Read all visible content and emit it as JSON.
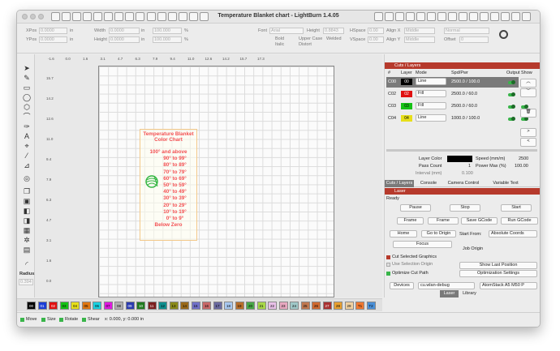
{
  "window": {
    "title": "Temperature Blanket chart - LightBurn 1.4.05"
  },
  "toolbar": {
    "xpos_label": "XPos",
    "xpos_value": "0.0000",
    "ypos_label": "YPos",
    "ypos_value": "0.0000",
    "unit": "in",
    "width_label": "Width",
    "width_value": "0.0000",
    "height_label": "Height",
    "height_value": "0.0000",
    "pct_w": "100.000",
    "pct_h": "100.000",
    "pct_sign": "%",
    "font_label": "Font",
    "font_value": "Arial",
    "height2_label": "Height",
    "height2_value": "0.8843",
    "hspace_label": "HSpace",
    "hspace_value": "0.00",
    "vspace_label": "VSpace",
    "vspace_value": "0.00",
    "alignx_label": "Align X",
    "alignx_value": "Middle",
    "aligny_label": "Align Y",
    "aligny_value": "Middle",
    "normal_value": "Normal",
    "offset_label": "Offset",
    "offset_value": "0",
    "bold": "Bold",
    "italic": "Italic",
    "upper_case": "Upper Case",
    "distort": "Distort",
    "welded": "Welded"
  },
  "rulers": {
    "top": [
      "-1.6",
      "0.0",
      "1.6",
      "3.1",
      "4.7",
      "6.3",
      "7.9",
      "9.4",
      "11.0",
      "12.6",
      "14.2",
      "15.7",
      "17.3"
    ],
    "left": [
      "15.7",
      "14.2",
      "12.6",
      "11.0",
      "9.4",
      "7.9",
      "6.3",
      "4.7",
      "3.1",
      "1.6",
      "0.0"
    ]
  },
  "design": {
    "title1": "Temperature Blanket",
    "title2": "Color Chart",
    "lines": [
      "100° and above",
      "90° to 99°",
      "80° to 89°",
      "70° to 79°",
      "60° to 69°",
      "50° to 59°",
      "40° to 49°",
      "30° to 39°",
      "20° to 29°",
      "10° to 19°",
      "0° to 9°",
      "Below Zero"
    ]
  },
  "left_tools": {
    "radius_label": "Radius:",
    "radius_value": "0.394"
  },
  "palette": [
    {
      "label": "00",
      "color": "#000000"
    },
    {
      "label": "01",
      "color": "#1a3dd6"
    },
    {
      "label": "02",
      "color": "#e01010"
    },
    {
      "label": "03",
      "color": "#15c215"
    },
    {
      "label": "04",
      "color": "#e7df1a"
    },
    {
      "label": "05",
      "color": "#e07712"
    },
    {
      "label": "06",
      "color": "#1ad0e0"
    },
    {
      "label": "07",
      "color": "#e01ae0"
    },
    {
      "label": "08",
      "color": "#b0b0b0"
    },
    {
      "label": "09",
      "color": "#2a3bb0"
    },
    {
      "label": "10",
      "color": "#1f7a1f"
    },
    {
      "label": "11",
      "color": "#7d1f1f"
    },
    {
      "label": "12",
      "color": "#0f8f8f"
    },
    {
      "label": "13",
      "color": "#8a8a1a"
    },
    {
      "label": "14",
      "color": "#9a6a1a"
    },
    {
      "label": "15",
      "color": "#7070c8"
    },
    {
      "label": "16",
      "color": "#c86868"
    },
    {
      "label": "17",
      "color": "#6a6aa0"
    },
    {
      "label": "18",
      "color": "#a8c8f0"
    },
    {
      "label": "19",
      "color": "#b86e2a"
    },
    {
      "label": "20",
      "color": "#48a848"
    },
    {
      "label": "21",
      "color": "#a8d848"
    },
    {
      "label": "22",
      "color": "#e8c0e8"
    },
    {
      "label": "23",
      "color": "#e8a8c0"
    },
    {
      "label": "24",
      "color": "#a0c8c8"
    },
    {
      "label": "25",
      "color": "#c07850"
    },
    {
      "label": "26",
      "color": "#d06a30"
    },
    {
      "label": "27",
      "color": "#a83030"
    },
    {
      "label": "28",
      "color": "#e8a030"
    },
    {
      "label": "29",
      "color": "#f0d0a0"
    },
    {
      "label": "T1",
      "color": "#f07830"
    },
    {
      "label": "T2",
      "color": "#4a90d8"
    }
  ],
  "status": {
    "move": "Move",
    "size": "Size",
    "rotate": "Rotate",
    "shear": "Shear",
    "coords": "x: 0.000, y: 0.000 in"
  },
  "cuts": {
    "header": "Cuts / Layers",
    "columns": [
      "#",
      "Layer",
      "Mode",
      "Spd/Pwr",
      "Output",
      "Show"
    ],
    "rows": [
      {
        "num": "C00",
        "layer": "00",
        "color": "#000000",
        "mode": "Line",
        "spd": "2500.0 / 100.0"
      },
      {
        "num": "C02",
        "layer": "02",
        "color": "#e01010",
        "mode": "Fill",
        "spd": "2500.0 / 60.0"
      },
      {
        "num": "C03",
        "layer": "03",
        "color": "#15c215",
        "mode": "Fill",
        "spd": "2500.0 / 60.0"
      },
      {
        "num": "C04",
        "layer": "04",
        "color": "#e7df1a",
        "mode": "Line",
        "spd": "1000.0 / 100.0"
      }
    ],
    "layer_color_label": "Layer Color",
    "speed_label": "Speed (mm/m)",
    "speed_value": "2500",
    "pass_label": "Pass Count",
    "pass_value": "1",
    "power_label": "Power Max (%)",
    "power_value": "100.00",
    "interval_label": "Interval (mm)",
    "interval_value": "0.100",
    "tabs": [
      "Cuts / Layers",
      "Console",
      "Camera Control",
      "Variable Text"
    ]
  },
  "laser": {
    "header": "Laser",
    "state": "Ready",
    "pause": "Pause",
    "stop": "Stop",
    "start": "Start",
    "frame1": "Frame",
    "frame2": "Frame",
    "save_gcode": "Save GCode",
    "run_gcode": "Run GCode",
    "home": "Home",
    "goto_origin": "Go to Origin",
    "start_from_label": "Start From:",
    "start_from_value": "Absolute Coords",
    "focus": "Focus",
    "job_origin": "Job Origin",
    "cut_selected": "Cut Selected Graphics",
    "use_selection_origin": "Use Selection Origin",
    "optimize_cut": "Optimize Cut Path",
    "show_last_position": "Show Last Position",
    "optimization_settings": "Optimization Settings",
    "devices": "Devices",
    "port_value": "cu.wlan-debug",
    "device_value": "AtomStack A5 M50 P",
    "bottom_tabs": [
      "Laser",
      "Library"
    ]
  }
}
